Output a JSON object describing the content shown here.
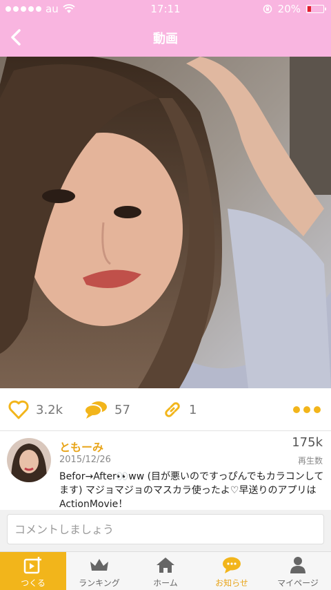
{
  "status_bar": {
    "carrier": "au",
    "time": "17:11",
    "battery_percent": "20%",
    "battery_level": 0.2
  },
  "nav": {
    "title": "動画",
    "back_icon": "chevron-left-icon"
  },
  "video": {
    "description_icon": "video-frame"
  },
  "actions": {
    "likes": "3.2k",
    "comments": "57",
    "links": "1",
    "like_icon": "heart-outline-icon",
    "comment_icon": "speech-bubbles-icon",
    "link_icon": "link-icon",
    "more_icon": "more-dots-icon"
  },
  "post": {
    "username": "ともーみ",
    "date": "2015/12/26",
    "views": "175k",
    "views_label": "再生数",
    "description": "Befor→After👀ww (目が悪いのですっぴんでもカラコンしてます) マジョマジョのマスカラ使ったよ♡早送りのアプリはActionMovie！"
  },
  "comment": {
    "placeholder": "コメントしましょう"
  },
  "tabs": [
    {
      "label": "つくる",
      "icon": "create-video-icon",
      "active": true
    },
    {
      "label": "ランキング",
      "icon": "crown-icon",
      "active": false
    },
    {
      "label": "ホーム",
      "icon": "home-icon",
      "active": false
    },
    {
      "label": "お知らせ",
      "icon": "speech-bubble-icon",
      "active": false
    },
    {
      "label": "マイページ",
      "icon": "person-icon",
      "active": false
    }
  ],
  "colors": {
    "header_pink": "#f9b5e0",
    "accent_yellow": "#f2b51b",
    "username_orange": "#e8a51b"
  }
}
